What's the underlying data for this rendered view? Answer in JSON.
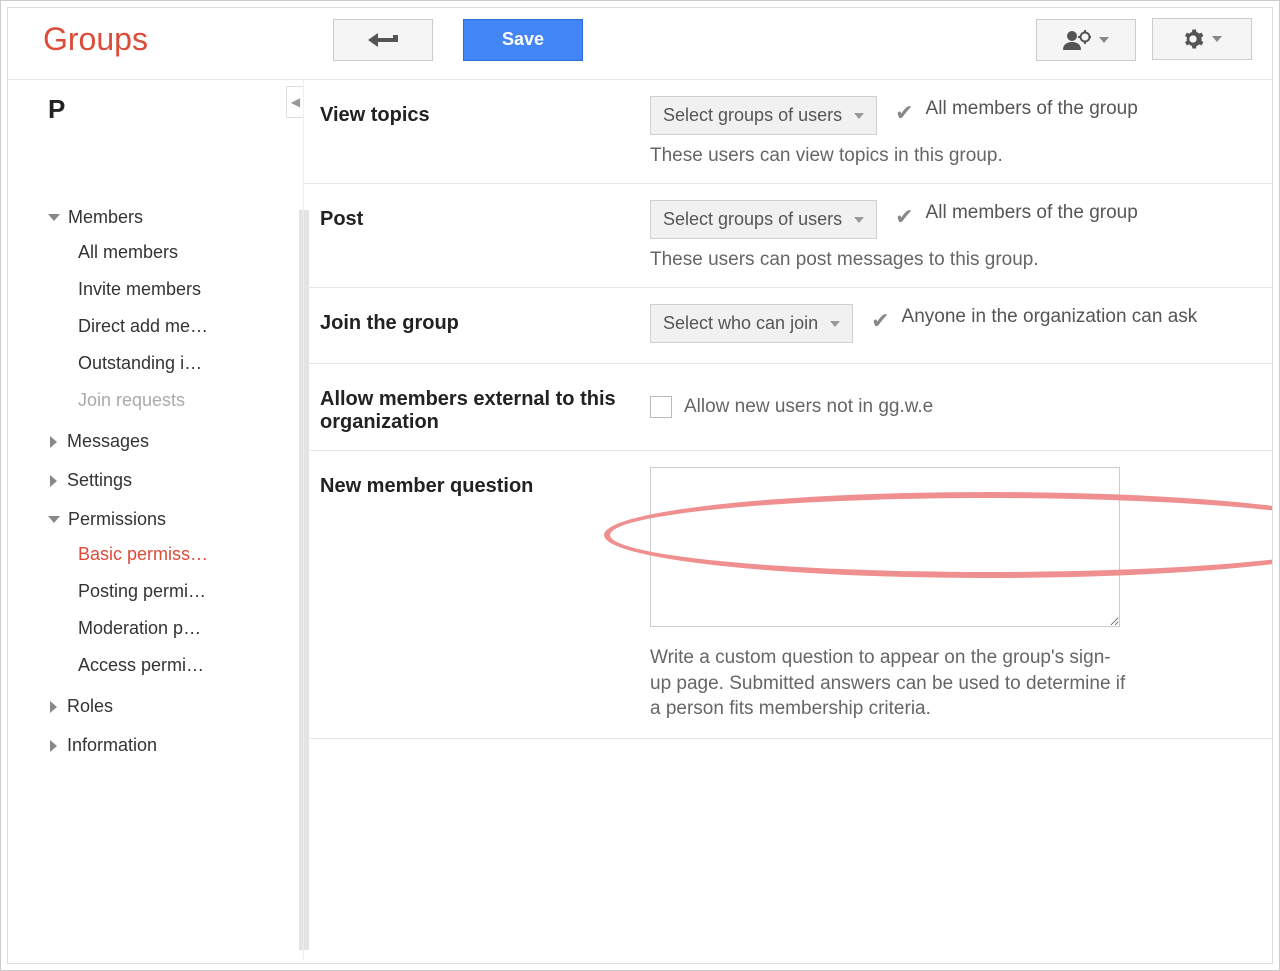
{
  "header": {
    "app_title": "Groups",
    "save_label": "Save"
  },
  "sidebar": {
    "top_letter": "P",
    "groups": [
      {
        "label": "Members",
        "expanded": true,
        "items": [
          {
            "label": "All members",
            "state": ""
          },
          {
            "label": "Invite members",
            "state": ""
          },
          {
            "label": "Direct add me…",
            "state": ""
          },
          {
            "label": "Outstanding i…",
            "state": ""
          },
          {
            "label": "Join requests",
            "state": "disabled"
          }
        ]
      },
      {
        "label": "Messages",
        "expanded": false
      },
      {
        "label": "Settings",
        "expanded": false
      },
      {
        "label": "Permissions",
        "expanded": true,
        "items": [
          {
            "label": "Basic permiss…",
            "state": "active"
          },
          {
            "label": "Posting permi…",
            "state": ""
          },
          {
            "label": "Moderation p…",
            "state": ""
          },
          {
            "label": "Access permi…",
            "state": ""
          }
        ]
      },
      {
        "label": "Roles",
        "expanded": false
      },
      {
        "label": "Information",
        "expanded": false
      }
    ]
  },
  "settings": {
    "view_topics": {
      "label": "View topics",
      "select": "Select groups of users",
      "summary": "All members of the group",
      "desc": "These users can view topics in this group."
    },
    "post": {
      "label": "Post",
      "select": "Select groups of users",
      "summary": "All members of the group",
      "desc": "These users can post messages to this group."
    },
    "join": {
      "label": "Join the group",
      "select": "Select who can join",
      "summary": "Anyone in the organization can ask"
    },
    "allow_external": {
      "label": "Allow members external to this organization",
      "checkbox_label": "Allow new users not in gg.w.e"
    },
    "new_member_question": {
      "label": "New member question",
      "desc": "Write a custom question to appear on the group's sign-up page. Submitted answers can be used to determine if a person fits membership criteria."
    }
  }
}
